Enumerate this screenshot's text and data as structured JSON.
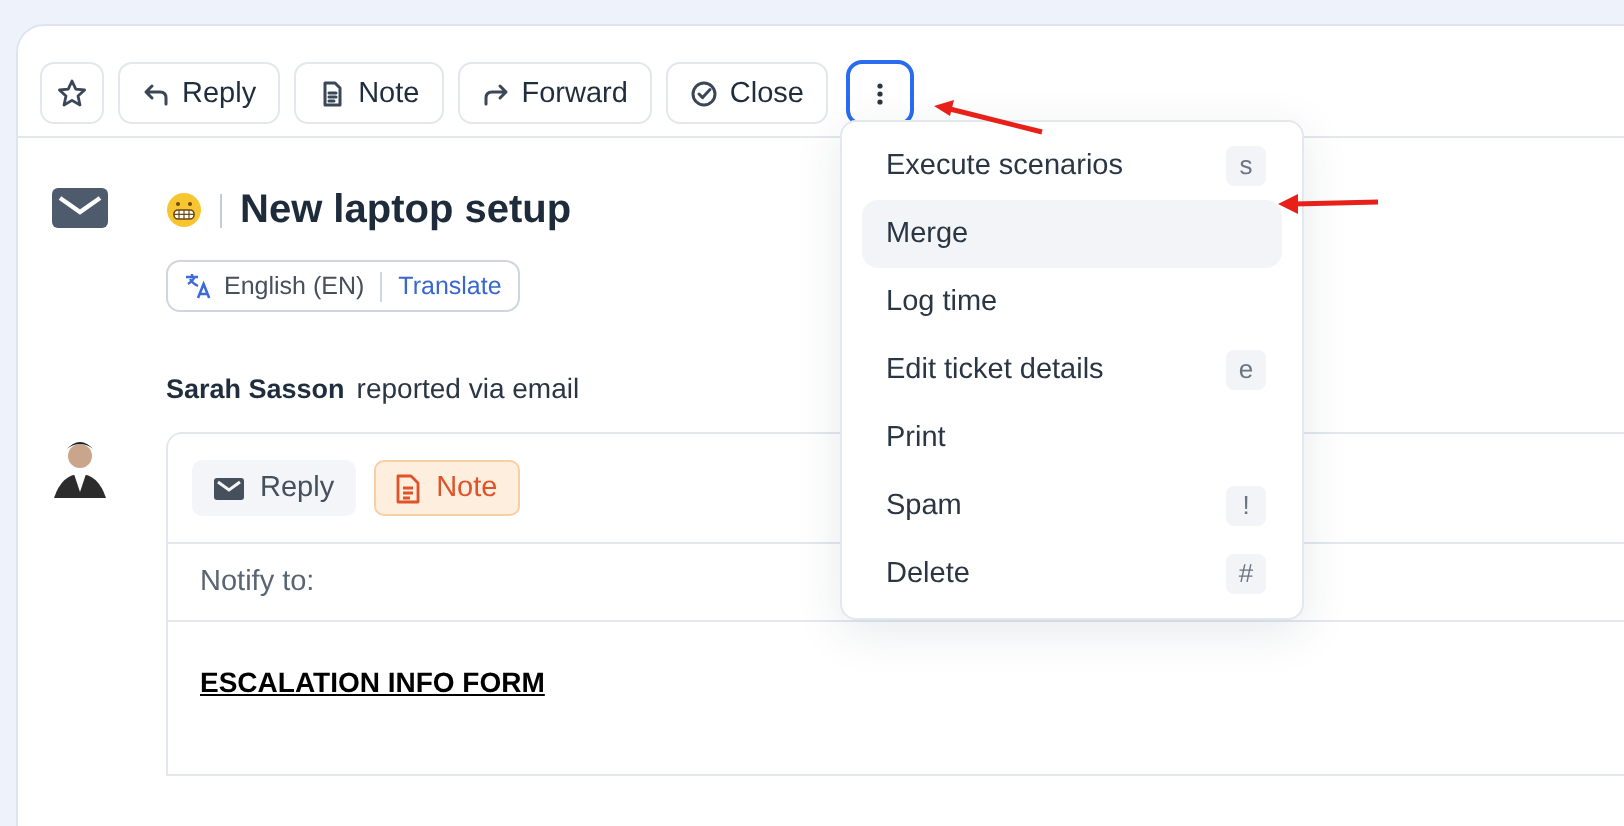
{
  "toolbar": {
    "star": {
      "starred": false
    },
    "buttons": [
      {
        "kind": "reply",
        "label": "Reply"
      },
      {
        "kind": "note",
        "label": "Note"
      },
      {
        "kind": "forward",
        "label": "Forward"
      },
      {
        "kind": "close",
        "label": "Close"
      }
    ],
    "more": {
      "open": true
    }
  },
  "menu": {
    "items": [
      {
        "label": "Execute scenarios",
        "shortcut": "s",
        "selected": false
      },
      {
        "label": "Merge",
        "selected": true
      },
      {
        "label": "Log time",
        "selected": false
      },
      {
        "label": "Edit ticket details",
        "shortcut": "e",
        "selected": false
      },
      {
        "label": "Print",
        "selected": false
      },
      {
        "label": "Spam",
        "shortcut": "!",
        "selected": false
      },
      {
        "label": "Delete",
        "shortcut": "#",
        "selected": false
      }
    ]
  },
  "ticket": {
    "title": "New laptop setup",
    "language": "English (EN)",
    "translate": "Translate",
    "reporter": "Sarah Sasson",
    "reported": "reported via email"
  },
  "composer": {
    "tabs": [
      {
        "kind": "reply",
        "label": "Reply",
        "selected": false
      },
      {
        "kind": "note",
        "label": "Note",
        "selected": true
      }
    ],
    "notify_label": "Notify to:",
    "body_heading": "ESCALATION INFO FORM"
  }
}
